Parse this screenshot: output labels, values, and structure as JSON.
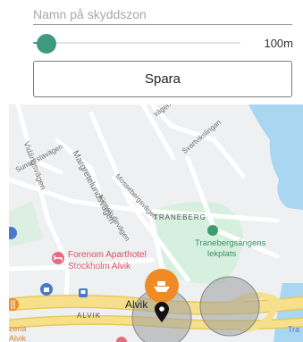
{
  "form": {
    "name_placeholder": "Namn på skyddszon",
    "name_value": "",
    "radius_label": "100m",
    "radius_fraction": 0.02,
    "save_label": "Spara"
  },
  "map": {
    "streets": {
      "margretelundsvagen": "Margretelundsvägen",
      "vidangsvagen": "Vidängsvägen",
      "mossebergsvagen": "Mossebergsvägen",
      "kinnekullevagen": "Kinnekullevägen",
      "svartvikslingan": "Svartvikslingan",
      "sunnerstavagen": "Sunnerstavägen",
      "vagen_top": "vägen"
    },
    "districts": {
      "traneberg": "TRANEBERG",
      "alvik_area": "ALVIK"
    },
    "pois": {
      "hotel_line1": "Forenom Aparthotel",
      "hotel_line2": "Stockholm Alvik",
      "park_line1": "Tranebergsängens",
      "park_line2": "lekplats",
      "station": "Alvik",
      "left_line1": "zeria",
      "left_line2": "Alvik",
      "right_edge": "Tra"
    },
    "icons": {
      "zone_marker": "boat-icon",
      "location": "location-pin-icon",
      "hotel": "bed-icon",
      "shop": "shopping-bag-icon",
      "transit": "bus-icon",
      "food": "fork-knife-icon"
    },
    "colors": {
      "zone_marker": "#f08a24",
      "zone_circle": "#9e9e9e",
      "water": "#a9d7f2",
      "park": "#cdeed8",
      "major_road": "#f7e08c",
      "hotel_poi": "#e76b80",
      "park_poi": "#3e9b6d",
      "transit": "#4a79c9"
    }
  }
}
